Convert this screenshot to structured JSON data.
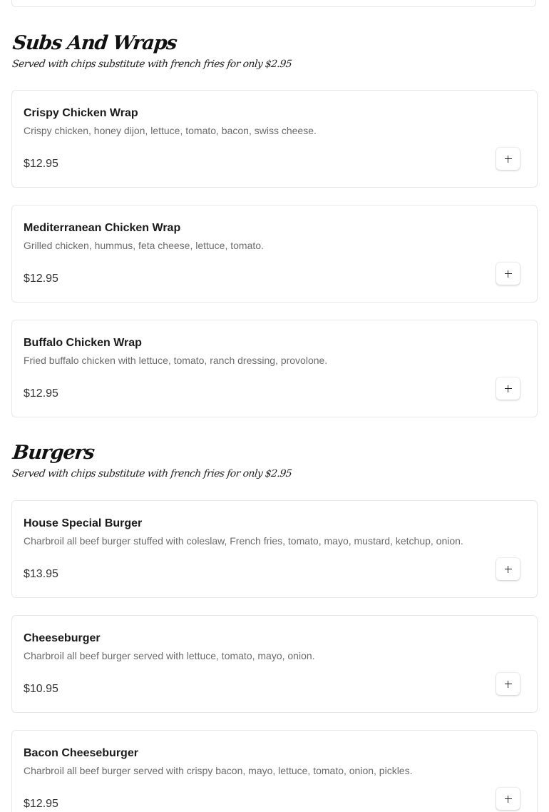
{
  "sections": [
    {
      "title": "Subs And Wraps",
      "subtitle": "Served with chips substitute with french fries for only $2.95",
      "items": [
        {
          "name": "Crispy Chicken Wrap",
          "description": "Crispy chicken, honey dijon, lettuce, tomato, bacon, swiss cheese.",
          "price": "$12.95"
        },
        {
          "name": "Mediterranean Chicken Wrap",
          "description": "Grilled chicken, hummus, feta cheese, lettuce, tomato.",
          "price": "$12.95"
        },
        {
          "name": "Buffalo Chicken Wrap",
          "description": "Fried buffalo chicken with lettuce, tomato, ranch dressing, provolone.",
          "price": "$12.95"
        }
      ]
    },
    {
      "title": "Burgers",
      "subtitle": "Served with chips substitute with french fries for only $2.95",
      "items": [
        {
          "name": "House Special Burger",
          "description": "Charbroil all beef burger stuffed with coleslaw, French fries, tomato, mayo, mustard, ketchup, onion.",
          "price": "$13.95"
        },
        {
          "name": "Cheeseburger",
          "description": "Charbroil all beef burger served with lettuce, tomato, mayo, onion.",
          "price": "$10.95"
        },
        {
          "name": "Bacon Cheeseburger",
          "description": "Charbroil all beef burger served with crispy bacon, mayo, lettuce, tomato, onion, pickles.",
          "price": "$12.95"
        }
      ]
    }
  ],
  "icons": {
    "add": "plus-icon"
  }
}
